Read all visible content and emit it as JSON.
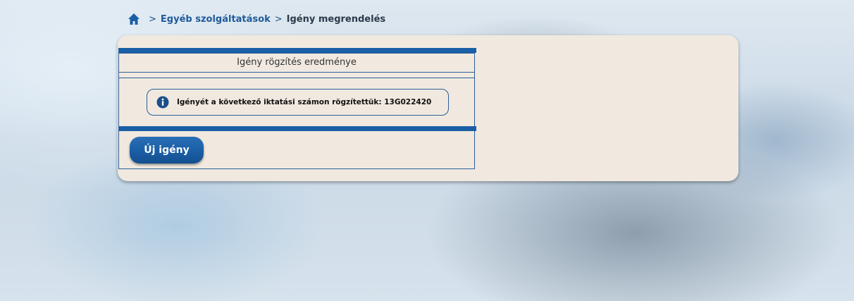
{
  "breadcrumb": {
    "home_icon": "home-icon",
    "separator": ">",
    "items": [
      {
        "label": "Egyéb szolgáltatások"
      },
      {
        "label": "Igény megrendelés"
      }
    ]
  },
  "result_box": {
    "title": "Igény rögzítés eredménye",
    "info_icon": "info-circle-icon",
    "message": "Igényét a következő iktatási számon rögzítettük: 13G022420"
  },
  "actions": {
    "new_request_label": "Új igény"
  },
  "colors": {
    "accent": "#1a5ea5",
    "panel": "#f1e9e0",
    "breadcrumb_text": "#1f5a9a"
  }
}
